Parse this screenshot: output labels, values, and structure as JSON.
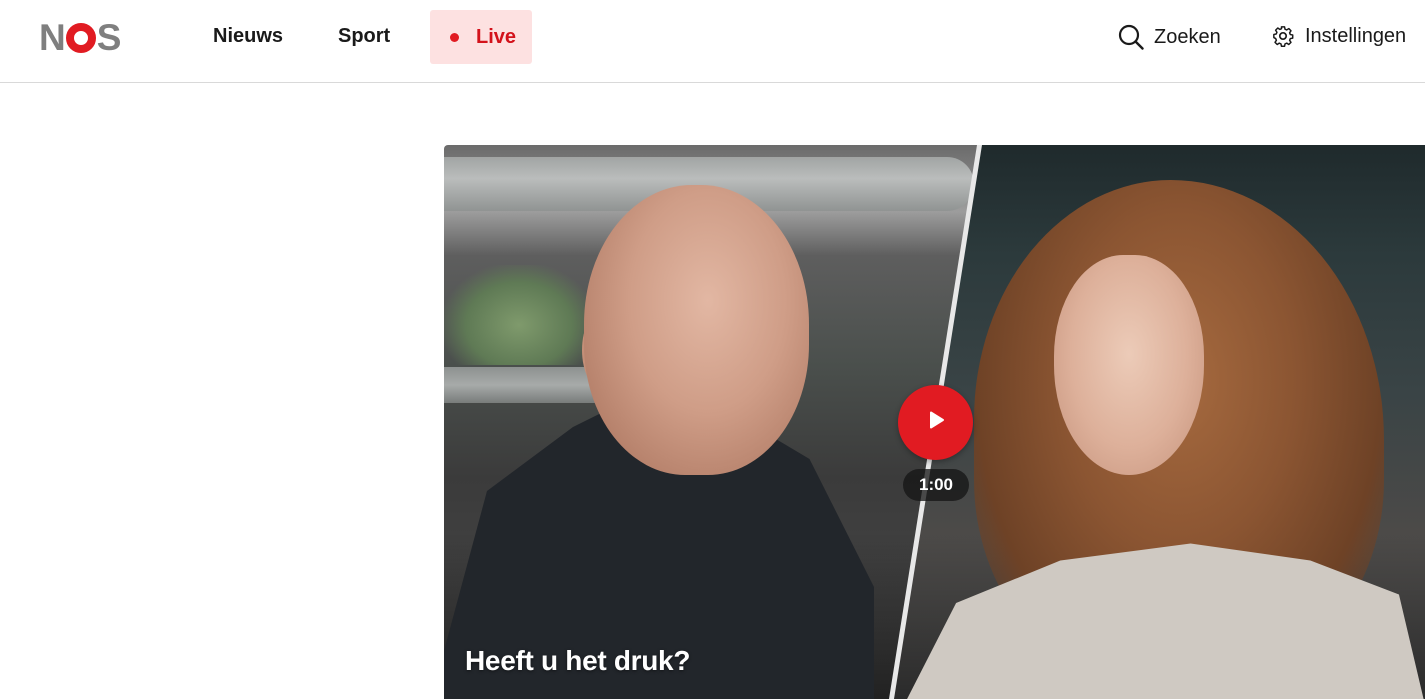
{
  "header": {
    "logo_text": "NOS",
    "nav": {
      "news_label": "Nieuws",
      "sport_label": "Sport",
      "live_label": "Live"
    },
    "search_label": "Zoeken",
    "settings_label": "Instellingen"
  },
  "video": {
    "title": "Heeft u het druk?",
    "duration": "1:00"
  },
  "colors": {
    "brand_red": "#e11b22",
    "live_bg": "#fde1e1",
    "logo_grey": "#7f7f7f"
  },
  "icons": {
    "search": "search-icon",
    "settings": "gear-icon",
    "play": "play-icon",
    "live_dot": "live-dot-icon"
  }
}
